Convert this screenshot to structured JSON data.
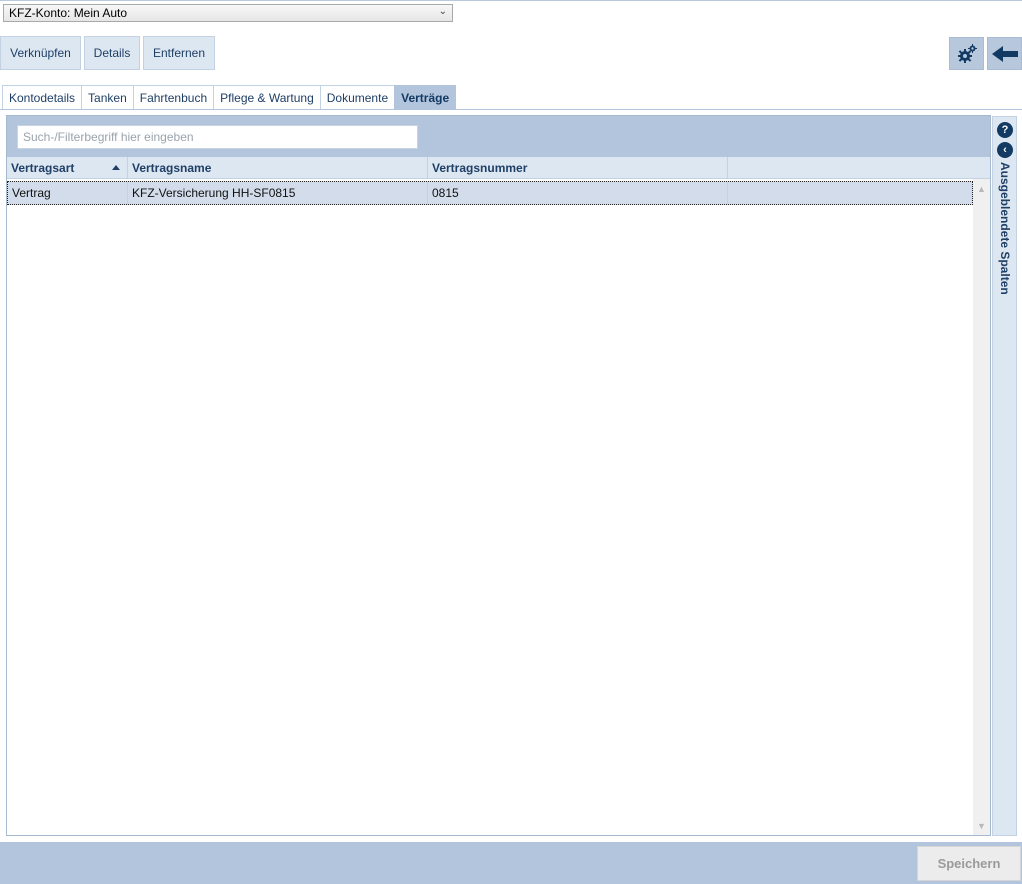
{
  "account": {
    "selected": "KFZ-Konto: Mein Auto"
  },
  "toolbar": {
    "link_label": "Verknüpfen",
    "details_label": "Details",
    "remove_label": "Entfernen"
  },
  "tabs": [
    {
      "label": "Kontodetails"
    },
    {
      "label": "Tanken"
    },
    {
      "label": "Fahrtenbuch"
    },
    {
      "label": "Pflege & Wartung"
    },
    {
      "label": "Dokumente"
    },
    {
      "label": "Verträge",
      "active": true
    }
  ],
  "search": {
    "placeholder": "Such-/Filterbegriff hier eingeben"
  },
  "grid": {
    "columns": [
      "Vertragsart",
      "Vertragsname",
      "Vertragsnummer"
    ],
    "sorted_column": "Vertragsart",
    "sort_direction": "ascending",
    "rows": [
      {
        "type": "Vertrag",
        "name": "KFZ-Versicherung HH-SF0815",
        "number": "0815"
      }
    ]
  },
  "side": {
    "help": "?",
    "collapse": "‹",
    "hidden_columns_label": "Ausgeblendete Spalten"
  },
  "footer": {
    "save_label": "Speichern"
  },
  "colors": {
    "accent": "#b3c5dc",
    "header": "#dde7f2",
    "text_primary": "#1f3f66",
    "dark_blue": "#123a63"
  },
  "icons": {
    "settings": "gears-icon",
    "back": "arrow-left-icon"
  }
}
